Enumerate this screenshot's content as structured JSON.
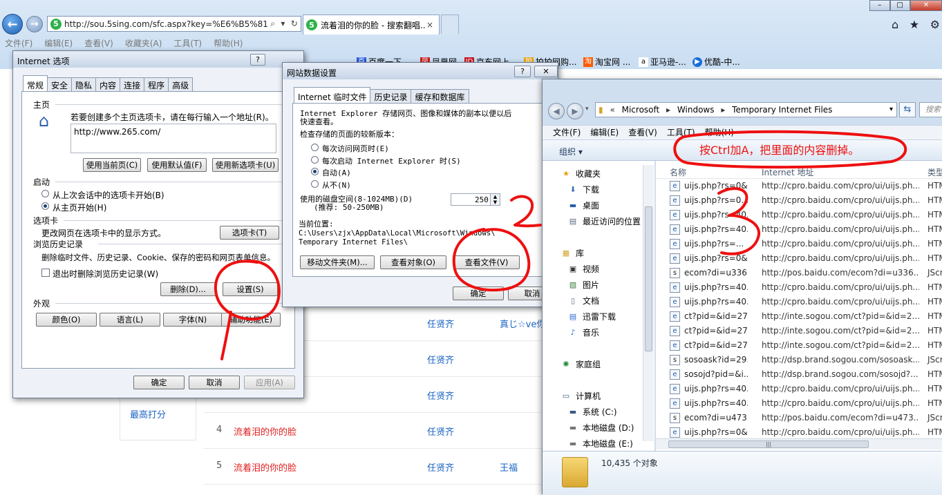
{
  "browser": {
    "address_url": "http://sou.5sing.com/sfc.aspx?key=%E6%B5%81%",
    "tab_title": "流着泪的你的脸 - 搜索翻唱...",
    "tab_close": "×",
    "site_icon_letter": "5",
    "menu": [
      "文件(F)",
      "编辑(E)",
      "查看(V)",
      "收藏夹(A)",
      "工具(T)",
      "帮助(H)"
    ],
    "favorites": [
      "百度一下...",
      "凤凰网",
      "京东网上...",
      "拍拍网购...",
      "淘宝网 ...",
      "亚马逊-...",
      "优酷-中..."
    ]
  },
  "page": {
    "rows": [
      {
        "num": "",
        "name": "",
        "artist": "任贤齐",
        "extra": "真じ☆ve你"
      },
      {
        "num": "",
        "name": "",
        "artist": "任贤齐",
        "extra": ""
      },
      {
        "num": "",
        "name": "",
        "artist": "任贤齐",
        "extra": ""
      },
      {
        "num": "4",
        "name": "流着泪的你的脸",
        "artist": "任贤齐",
        "extra": ""
      },
      {
        "num": "5",
        "name": "流着泪的你的脸",
        "artist": "任贤齐",
        "extra": "王福"
      }
    ],
    "left_link": "最高打分"
  },
  "internet_options": {
    "title": "Internet 选项",
    "help": "?",
    "tabs": [
      "常规",
      "安全",
      "隐私",
      "内容",
      "连接",
      "程序",
      "高级"
    ],
    "home_section": "主页",
    "home_desc": "若要创建多个主页选项卡，请在每行输入一个地址(R)。",
    "home_url": "http://www.265.com/",
    "btn_use_current": "使用当前页(C)",
    "btn_use_default": "使用默认值(F)",
    "btn_use_new_tab": "使用新选项卡(U)",
    "startup_section": "启动",
    "startup_opt1": "从上次会话中的选项卡开始(B)",
    "startup_opt2": "从主页开始(H)",
    "tabs_section": "选项卡",
    "tabs_desc": "更改网页在选项卡中的显示方式。",
    "btn_tabs": "选项卡(T)",
    "history_section": "浏览历史记录",
    "history_desc": "删除临时文件、历史记录、Cookie、保存的密码和网页表单信息。",
    "history_check": "退出时删除浏览历史记录(W)",
    "btn_delete": "删除(D)...",
    "btn_settings": "设置(S)",
    "appearance_section": "外观",
    "btn_colors": "颜色(O)",
    "btn_languages": "语言(L)",
    "btn_fonts": "字体(N)",
    "btn_accessibility": "辅助功能(E)",
    "btn_ok": "确定",
    "btn_cancel": "取消",
    "btn_apply": "应用(A)"
  },
  "website_data": {
    "title": "网站数据设置",
    "help": "?",
    "tabs": [
      "Internet 临时文件",
      "历史记录",
      "缓存和数据库"
    ],
    "desc1": "Internet Explorer 存储网页、图像和媒体的副本以便以后",
    "desc2": "快速查看。",
    "check_label": "检查存储的页面的较新版本：",
    "opt1": "每次访问网页时(E)",
    "opt2": "每次启动 Internet Explorer 时(S)",
    "opt3": "自动(A)",
    "opt4": "从不(N)",
    "disk_label": "使用的磁盘空间(8-1024MB)(D)",
    "disk_recommend": "(推荐: 50-250MB)",
    "disk_value": "250",
    "location_label": "当前位置:",
    "location_path1": "C:\\Users\\zjx\\AppData\\Local\\Microsoft\\Windows\\",
    "location_path2": "Temporary Internet Files\\",
    "btn_move": "移动文件夹(M)...",
    "btn_view_objects": "查看对象(O)",
    "btn_view_files": "查看文件(V)",
    "btn_ok": "确定",
    "btn_cancel": "取消"
  },
  "explorer": {
    "path": [
      "«",
      "Microsoft",
      "Windows",
      "Temporary Internet Files"
    ],
    "search_placeholder": "搜索",
    "menu": [
      "文件(F)",
      "编辑(E)",
      "查看(V)",
      "工具(T)",
      "帮助(H)"
    ],
    "organize": "组织 ▾",
    "nav": {
      "favorites": "收藏夹",
      "downloads": "下载",
      "desktop": "桌面",
      "recent": "最近访问的位置",
      "library": "库",
      "videos": "视频",
      "pictures": "图片",
      "documents": "文档",
      "thunder": "迅雷下载",
      "music": "音乐",
      "homegroup": "家庭组",
      "computer": "计算机",
      "drive_c": "系统 (C:)",
      "drive_d": "本地磁盘 (D:)",
      "drive_e": "本地磁盘 (E:)"
    },
    "columns": {
      "name": "名称",
      "address": "Internet 地址",
      "type": "类型"
    },
    "files": [
      {
        "name": "uijs.php?rs=0&...",
        "address": "http://cpro.baidu.com/cpro/ui/uijs.ph...",
        "type": "HTM",
        "icon": "e"
      },
      {
        "name": "uijs.php?rs=0...",
        "address": "http://cpro.baidu.com/cpro/ui/uijs.ph...",
        "type": "HTM",
        "icon": "e"
      },
      {
        "name": "uijs.php?rs=40...",
        "address": "http://cpro.baidu.com/cpro/ui/uijs.ph...",
        "type": "HTM",
        "icon": "e"
      },
      {
        "name": "uijs.php?rs=40...",
        "address": "http://cpro.baidu.com/cpro/ui/uijs.ph...",
        "type": "HTM",
        "icon": "e"
      },
      {
        "name": "uijs.php?rs=...",
        "address": "http://cpro.baidu.com/cpro/ui/uijs.ph...",
        "type": "HTM",
        "icon": "e"
      },
      {
        "name": "uijs.php?rs=0&...",
        "address": "http://cpro.baidu.com/cpro/ui/uijs.ph...",
        "type": "HTM",
        "icon": "e"
      },
      {
        "name": "ecom?di=u336...",
        "address": "http://pos.baidu.com/ecom?di=u336...",
        "type": "JScri",
        "icon": "s"
      },
      {
        "name": "uijs.php?rs=40...",
        "address": "http://cpro.baidu.com/cpro/ui/uijs.ph...",
        "type": "HTM",
        "icon": "e"
      },
      {
        "name": "uijs.php?rs=40...",
        "address": "http://cpro.baidu.com/cpro/ui/uijs.ph...",
        "type": "HTM",
        "icon": "e"
      },
      {
        "name": "ct?pid=&id=27...",
        "address": "http://inte.sogou.com/ct?pid=&id=2...",
        "type": "HTM",
        "icon": "e"
      },
      {
        "name": "ct?pid=&id=27...",
        "address": "http://inte.sogou.com/ct?pid=&id=2...",
        "type": "HTM",
        "icon": "e"
      },
      {
        "name": "ct?pid=&id=27...",
        "address": "http://inte.sogou.com/ct?pid=&id=2...",
        "type": "HTM",
        "icon": "e"
      },
      {
        "name": "sosoask?id=29...",
        "address": "http://dsp.brand.sogou.com/sosoask...",
        "type": "JScri",
        "icon": "s"
      },
      {
        "name": "sosojd?pid=&i...",
        "address": "http://dsp.brand.sogou.com/sosojd?...",
        "type": "HTM",
        "icon": "e"
      },
      {
        "name": "uijs.php?rs=40...",
        "address": "http://cpro.baidu.com/cpro/ui/uijs.ph...",
        "type": "HTM",
        "icon": "e"
      },
      {
        "name": "uijs.php?rs=40...",
        "address": "http://cpro.baidu.com/cpro/ui/uijs.ph...",
        "type": "HTM",
        "icon": "e"
      },
      {
        "name": "ecom?di=u473...",
        "address": "http://pos.baidu.com/ecom?di=u473...",
        "type": "JScri",
        "icon": "s"
      },
      {
        "name": "uijs.php?rs=0&...",
        "address": "http://cpro.baidu.com/cpro/ui/uijs.ph...",
        "type": "HTM",
        "icon": "e"
      }
    ],
    "status": "10,435 个对象"
  },
  "annotation": {
    "text": "按Ctrl加A，把里面的内容删掉。",
    "color": "#ee1010"
  }
}
